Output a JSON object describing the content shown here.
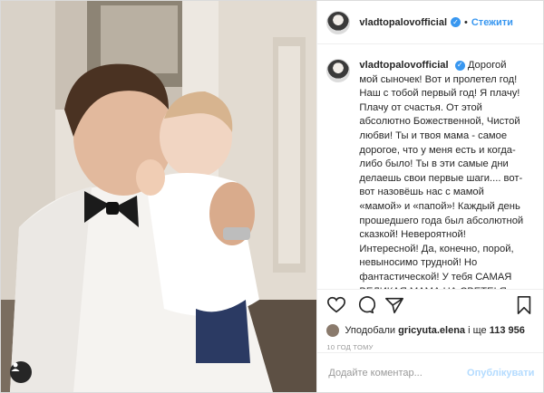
{
  "post": {
    "username": "vladtopalovofficial",
    "follow_label": "Стежити",
    "caption_username": "vladtopalovofficial",
    "caption_text": "Дорогой мой сыночек! Вот и пролетел год! Наш с тобой первый год! Я плачу! Плачу от счастья. От этой абсолютно Божественной, Чистой любви! Ты и твоя мама - самое дорогое, что у меня есть и когда-либо было! Ты в эти самые дни делаешь свои первые шаги.... вот-вот назовёшь нас с мамой «мамой» и «папой»! Каждый день прошедшего года был абсолютной сказкой! Невероятной! Интересной! Да, конечно, порой, невыносимо трудной! Но фантастической! У тебя САМАЯ ВЕЛИКАЯ МАМА НА СВЕТЕ! Я очень надеюсь ты это читаешь уже взрослый когда-то) Береги свою маму! Люби её и уважай! Она совершает ПОДВИГ для тебя",
    "likes_prefix": "Уподобали",
    "likes_user": "gricyuta.elena",
    "likes_middle": "і ще",
    "likes_count": "113 956",
    "time_ago": "10 ГОД ТОМУ",
    "comment_placeholder": "Додайте коментар...",
    "publish_label": "Опублікувати"
  },
  "icons": {
    "verified": "verified-badge-icon",
    "like": "heart-icon",
    "comment": "comment-icon",
    "share": "share-icon",
    "save": "bookmark-icon",
    "user_tag": "user-tag-icon"
  },
  "colors": {
    "link": "#3897f0",
    "publish_disabled": "#b3dbff",
    "muted": "#999999",
    "text": "#262626"
  }
}
